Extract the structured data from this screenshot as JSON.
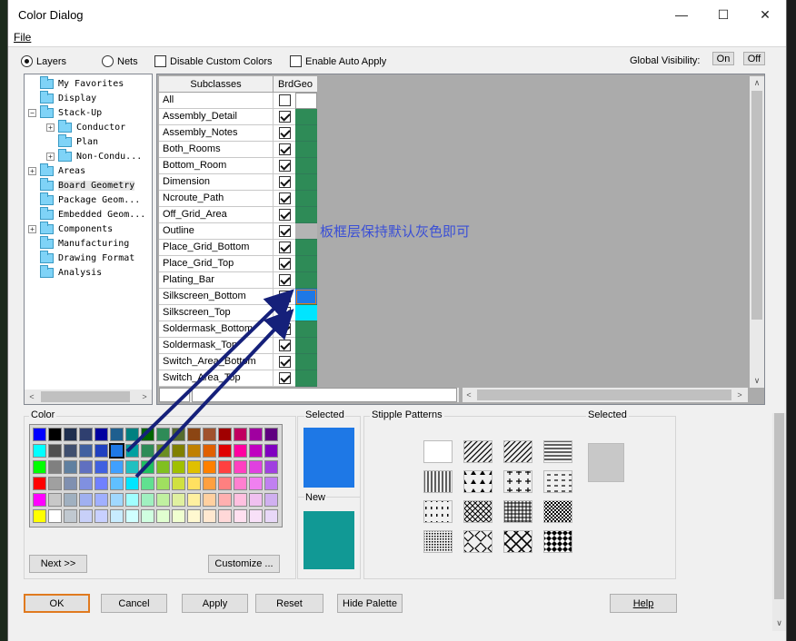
{
  "window": {
    "title": "Color Dialog",
    "menu_file": "File",
    "minimize_glyph": "—",
    "maximize_glyph": "☐",
    "close_glyph": "✕"
  },
  "top_bar": {
    "radio_layers": "Layers",
    "radio_nets": "Nets",
    "disable_custom": "Disable Custom Colors",
    "enable_auto": "Enable Auto Apply",
    "global_visibility": "Global Visibility:",
    "on_label": "On",
    "off_label": "Off"
  },
  "tree": {
    "items": [
      {
        "label": "My Favorites",
        "expander": ""
      },
      {
        "label": "Display",
        "expander": ""
      },
      {
        "label": "Stack-Up",
        "expander": "−"
      },
      {
        "label": "Conductor",
        "expander": "+"
      },
      {
        "label": "Plan",
        "expander": ""
      },
      {
        "label": "Non-Condu...",
        "expander": "+"
      },
      {
        "label": "Areas",
        "expander": "+"
      },
      {
        "label": "Board Geometry",
        "expander": ""
      },
      {
        "label": "Package Geom...",
        "expander": ""
      },
      {
        "label": "Embedded Geom...",
        "expander": ""
      },
      {
        "label": "Components",
        "expander": "+"
      },
      {
        "label": "Manufacturing",
        "expander": ""
      },
      {
        "label": "Drawing Format",
        "expander": ""
      },
      {
        "label": "Analysis",
        "expander": ""
      }
    ],
    "scroll_left": "<",
    "scroll_right": ">"
  },
  "grid": {
    "col_subclasses": "Subclasses",
    "col_brdgeo": "BrdGeo",
    "rows": [
      {
        "name": "All",
        "checked": false,
        "color": "#ffffff"
      },
      {
        "name": "Assembly_Detail",
        "checked": true,
        "color": "#2e8b57"
      },
      {
        "name": "Assembly_Notes",
        "checked": true,
        "color": "#2e8b57"
      },
      {
        "name": "Both_Rooms",
        "checked": true,
        "color": "#2e8b57"
      },
      {
        "name": "Bottom_Room",
        "checked": true,
        "color": "#2e8b57"
      },
      {
        "name": "Dimension",
        "checked": true,
        "color": "#2e8b57"
      },
      {
        "name": "Ncroute_Path",
        "checked": true,
        "color": "#2e8b57"
      },
      {
        "name": "Off_Grid_Area",
        "checked": true,
        "color": "#2e8b57"
      },
      {
        "name": "Outline",
        "checked": true,
        "color": "#b4b4b4"
      },
      {
        "name": "Place_Grid_Bottom",
        "checked": true,
        "color": "#2e8b57"
      },
      {
        "name": "Place_Grid_Top",
        "checked": true,
        "color": "#2e8b57"
      },
      {
        "name": "Plating_Bar",
        "checked": true,
        "color": "#2e8b57"
      },
      {
        "name": "Silkscreen_Bottom",
        "checked": true,
        "color": "#1e78e6"
      },
      {
        "name": "Silkscreen_Top",
        "checked": true,
        "color": "#00e5ff"
      },
      {
        "name": "Soldermask_Bottom",
        "checked": true,
        "color": "#2e8b57"
      },
      {
        "name": "Soldermask_Top",
        "checked": true,
        "color": "#2e8b57"
      },
      {
        "name": "Switch_Area_Bottom",
        "checked": true,
        "color": "#2e8b57"
      },
      {
        "name": "Switch_Area_Top",
        "checked": true,
        "color": "#2e8b57"
      }
    ],
    "annotation": "板框层保持默认灰色即可",
    "annotation_color": "#3a4fd6"
  },
  "color_panel": {
    "label": "Color",
    "palette": [
      [
        "#0000ff",
        "#000000",
        "#1f2f4f",
        "#2f3f6f",
        "#0000a0",
        "#1f5f8f",
        "#008080",
        "#006400",
        "#2e8b57",
        "#556b2f",
        "#8b4513",
        "#a0522d",
        "#a00000",
        "#c00060",
        "#a000a0",
        "#600080"
      ],
      [
        "#00ffff",
        "#505050",
        "#3f4f6f",
        "#4060a0",
        "#2040c0",
        "#1e78e6",
        "#00a0a0",
        "#2e8b57",
        "#6b8e23",
        "#808000",
        "#c08000",
        "#e06000",
        "#e00000",
        "#ff00a0",
        "#c000c0",
        "#8000c0"
      ],
      [
        "#00ff00",
        "#808080",
        "#6080a0",
        "#6070c0",
        "#4060e0",
        "#40a0ff",
        "#20c0c0",
        "#20c060",
        "#80c020",
        "#a0c000",
        "#e0c000",
        "#ff8000",
        "#ff4040",
        "#ff40c0",
        "#e040e0",
        "#a040e0"
      ],
      [
        "#ff0000",
        "#a0a0a0",
        "#8090b0",
        "#8090e0",
        "#7080ff",
        "#60c0ff",
        "#00e5ff",
        "#60e090",
        "#a0e060",
        "#d0e040",
        "#ffe060",
        "#ffa040",
        "#ff8080",
        "#ff80d0",
        "#f080f0",
        "#c080f0"
      ],
      [
        "#ff00ff",
        "#c8c8c8",
        "#a0b0c0",
        "#a0b0f0",
        "#a0b0ff",
        "#a0d8ff",
        "#a0ffff",
        "#a0f0c0",
        "#c0f0a0",
        "#e0f0a0",
        "#fff0a0",
        "#ffd0a0",
        "#ffb0b0",
        "#ffc0e0",
        "#f0c0f0",
        "#d0b0f0"
      ],
      [
        "#ffff00",
        "#ffffff",
        "#c0c8d0",
        "#c8d0f8",
        "#c8d0ff",
        "#c8ecff",
        "#d0ffff",
        "#d0ffe0",
        "#e0ffd0",
        "#f0ffd0",
        "#fff8d0",
        "#ffe8d0",
        "#ffd8d8",
        "#ffe0f0",
        "#f8e0f8",
        "#e8d8f8"
      ]
    ],
    "next_button": "Next >>",
    "customize_button": "Customize ..."
  },
  "selected_panel": {
    "selected_label": "Selected",
    "selected_color": "#1e78e6",
    "new_label": "New",
    "new_color": "#119995"
  },
  "stipple": {
    "label": "Stipple Patterns",
    "selected_label": "Selected",
    "selected_color": "#c8c8c8"
  },
  "buttons": {
    "ok": "OK",
    "cancel": "Cancel",
    "apply": "Apply",
    "reset": "Reset",
    "hide_palette": "Hide Palette",
    "help": "Help"
  }
}
